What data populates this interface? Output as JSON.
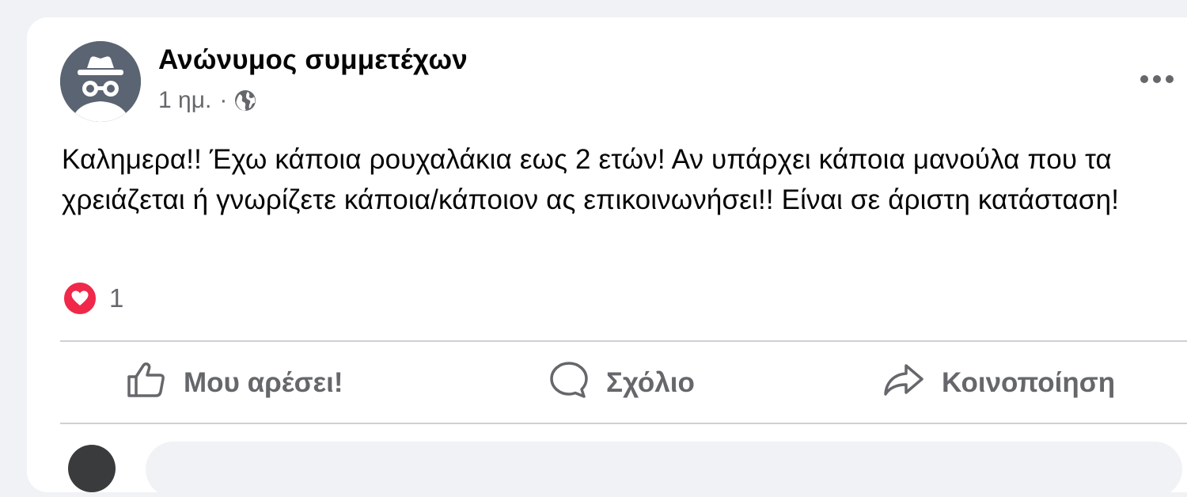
{
  "post": {
    "author": "Ανώνυμος συμμετέχων",
    "time": "1 ημ.",
    "separator": "·",
    "visibility_icon": "globe-icon",
    "menu_icon": "more-options-icon",
    "text": "Καλημερα!! Έχω κάποια ρουχαλάκια εως 2 ετών! Αν υπάρχει κάποια μανούλα που τα χρειάζεται ή γνωρίζετε κάποια/κάποιον ας επικοινωνήσει!! Είναι σε άριστη κατάσταση!",
    "reactions": {
      "icon": "heart-reaction-icon",
      "count": "1"
    }
  },
  "actions": {
    "like": "Μου αρέσει!",
    "comment": "Σχόλιο",
    "share": "Κοινοποίηση"
  },
  "colors": {
    "page_background": "#f0f2f5",
    "card_background": "#ffffff",
    "primary_text": "#050505",
    "secondary_text": "#65676b",
    "divider": "#ced0d4",
    "heart": "#f0284a",
    "avatar": "#5b6472"
  }
}
